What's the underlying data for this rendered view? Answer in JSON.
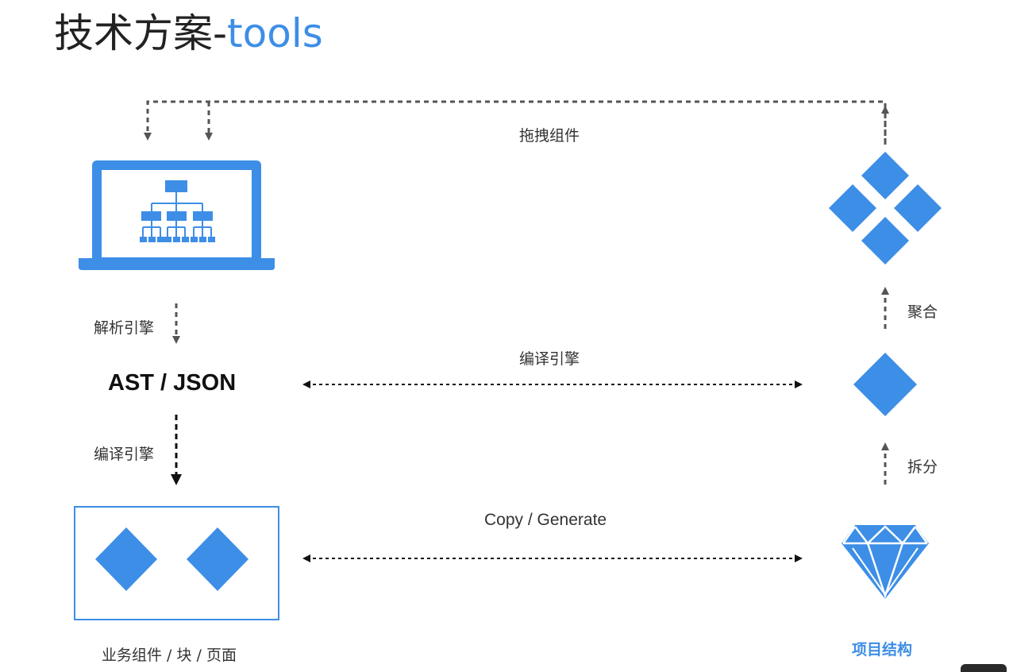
{
  "title": {
    "main": "技术方案-",
    "accent": "tools"
  },
  "labels": {
    "drag": "拖拽组件",
    "parse": "解析引擎",
    "compile_left": "编译引擎",
    "compile_mid": "编译引擎",
    "aggregate": "聚合",
    "split": "拆分",
    "ast": "AST / JSON",
    "copy_generate": "Copy / Generate",
    "business": "业务组件 /  块 / 页面",
    "project": "项目结构"
  },
  "colors": {
    "accent": "#3d8ee6",
    "arrow": "#555555"
  },
  "icons": [
    "laptop-sitemap-icon",
    "four-diamonds-icon",
    "single-diamond-icon",
    "gem-icon",
    "two-diamonds-box"
  ]
}
